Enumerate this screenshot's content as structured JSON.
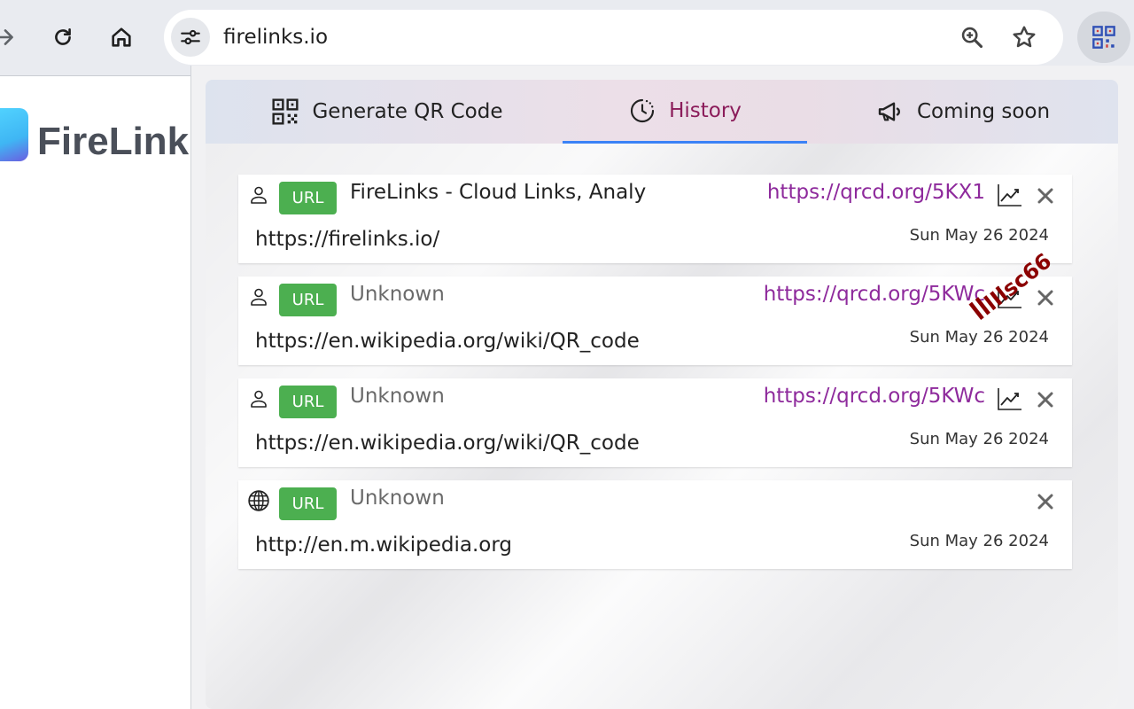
{
  "browser": {
    "url": "firelinks.io",
    "icons": {
      "forward": "arrow-forward-icon",
      "reload": "reload-icon",
      "home": "home-icon",
      "site_info": "tune-icon",
      "zoom": "zoom-in-icon",
      "bookmark": "star-icon",
      "extension": "qr-extension-icon"
    }
  },
  "site": {
    "logo_text": "FireLink"
  },
  "tabs": [
    {
      "label": "Generate QR Code",
      "icon": "qr-code-icon"
    },
    {
      "label": "History",
      "icon": "clock-icon",
      "active": true
    },
    {
      "label": "Coming soon",
      "icon": "megaphone-icon"
    }
  ],
  "history": [
    {
      "icon": "person-icon",
      "badge": "URL",
      "title": "FireLinks - Cloud Links, Analy",
      "short_link": "https://qrcd.org/5KX1",
      "url": "https://firelinks.io/",
      "date": "Sun May 26 2024"
    },
    {
      "icon": "person-icon",
      "badge": "URL",
      "title": "Unknown",
      "short_link": "https://qrcd.org/5KWc",
      "url": "https://en.wikipedia.org/wiki/QR_code",
      "date": "Sun May 26 2024"
    },
    {
      "icon": "person-icon",
      "badge": "URL",
      "title": "Unknown",
      "short_link": "https://qrcd.org/5KWc",
      "url": "https://en.wikipedia.org/wiki/QR_code",
      "date": "Sun May 26 2024"
    },
    {
      "icon": "globe-icon",
      "badge": "URL",
      "title": "Unknown",
      "short_link": "",
      "url": "http://en.m.wikipedia.org",
      "date": "Sun May 26 2024"
    }
  ],
  "watermark": "ꟾꟾlIlsc66",
  "colors": {
    "badge": "#4caf50",
    "short_link": "#8e2a9c",
    "active_tab_text": "#8b1c5a",
    "active_tab_underline": "#3b82f6",
    "watermark": "#8b0000"
  }
}
